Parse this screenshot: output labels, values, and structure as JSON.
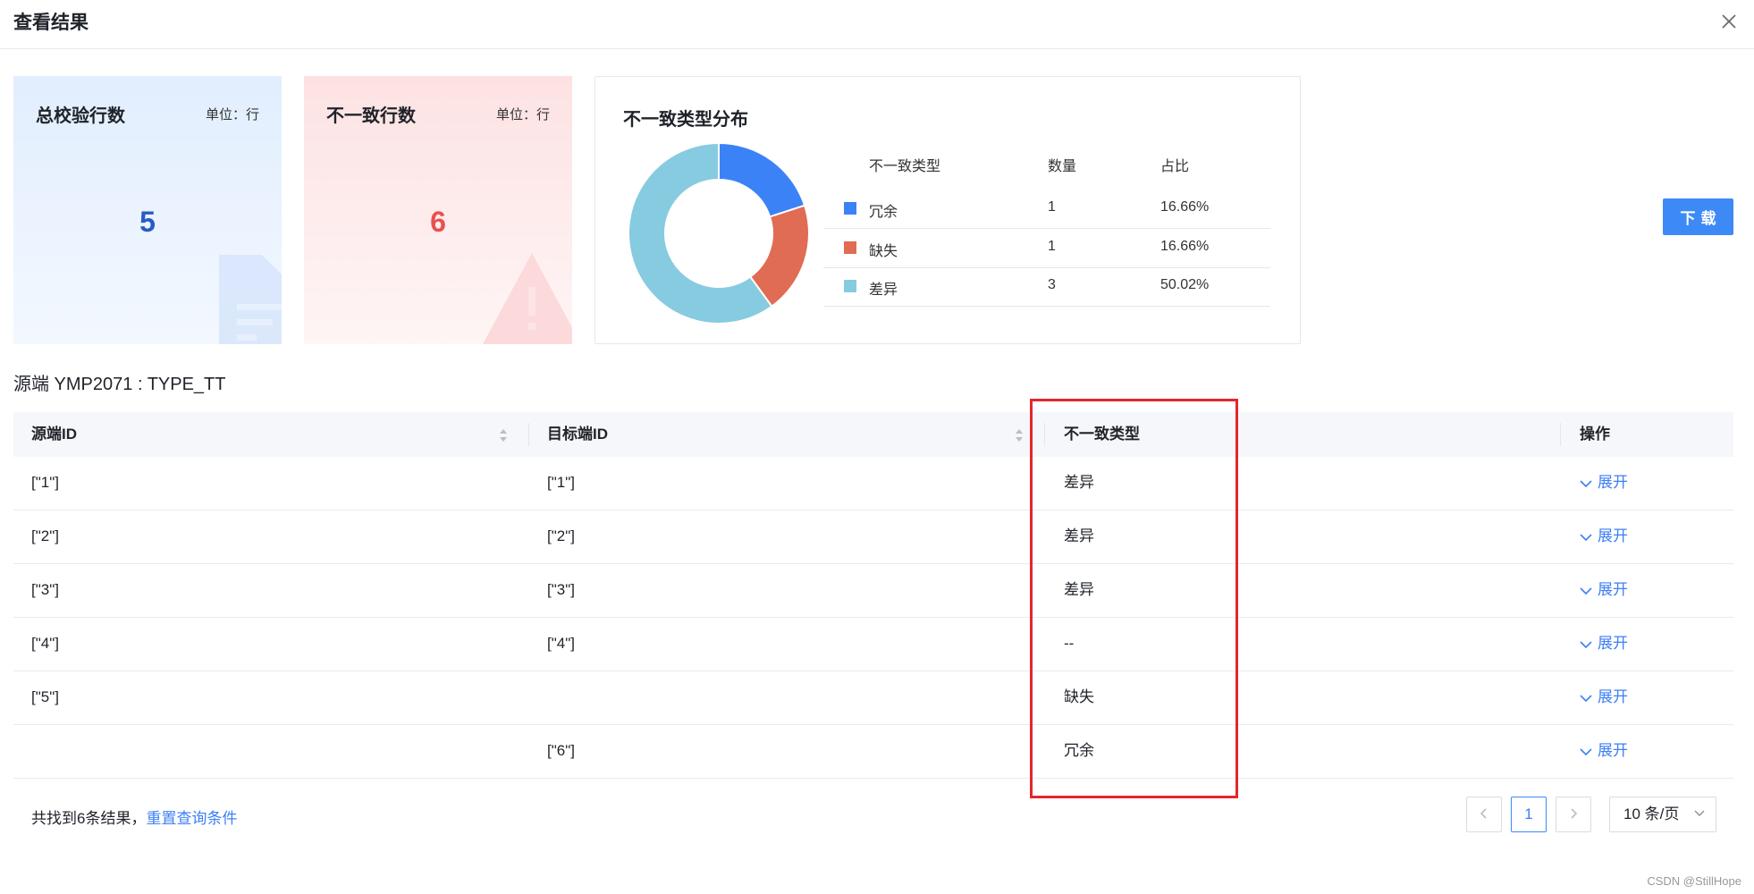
{
  "dialog": {
    "title": "查看结果"
  },
  "cards": {
    "total": {
      "title": "总校验行数",
      "unit": "单位：行",
      "value": "5"
    },
    "mismatch": {
      "title": "不一致行数",
      "unit": "单位：行",
      "value": "6"
    }
  },
  "distribution": {
    "title": "不一致类型分布",
    "headers": [
      "不一致类型",
      "数量",
      "占比"
    ],
    "rows": [
      {
        "type": "冗余",
        "count": "1",
        "ratio": "16.66%",
        "color": "#3b82f6"
      },
      {
        "type": "缺失",
        "count": "1",
        "ratio": "16.66%",
        "color": "#e06c53"
      },
      {
        "type": "差异",
        "count": "3",
        "ratio": "50.02%",
        "color": "#87cbe0"
      }
    ]
  },
  "chart_data": {
    "type": "pie",
    "title": "不一致类型分布",
    "categories": [
      "冗余",
      "缺失",
      "差异"
    ],
    "values": [
      1,
      1,
      3
    ],
    "colors": [
      "#3b82f6",
      "#e06c53",
      "#87cbe0"
    ],
    "donut": true
  },
  "download_label": "下载",
  "section_title": "源端 YMP2071 : TYPE_TT",
  "table": {
    "columns": [
      "源端ID",
      "目标端ID",
      "不一致类型",
      "操作"
    ],
    "rows": [
      {
        "source": "[\"1\"]",
        "target": "[\"1\"]",
        "type": "差异",
        "action": "展开"
      },
      {
        "source": "[\"2\"]",
        "target": "[\"2\"]",
        "type": "差异",
        "action": "展开"
      },
      {
        "source": "[\"3\"]",
        "target": "[\"3\"]",
        "type": "差异",
        "action": "展开"
      },
      {
        "source": "[\"4\"]",
        "target": "[\"4\"]",
        "type": "--",
        "action": "展开"
      },
      {
        "source": "[\"5\"]",
        "target": "",
        "type": "缺失",
        "action": "展开"
      },
      {
        "source": "",
        "target": "[\"6\"]",
        "type": "冗余",
        "action": "展开"
      }
    ]
  },
  "footer": {
    "result_text": "共找到6条结果，",
    "reset_label": "重置查询条件"
  },
  "pagination": {
    "current_page": "1",
    "page_size": "10 条/页"
  },
  "watermark": "CSDN @StillHope"
}
